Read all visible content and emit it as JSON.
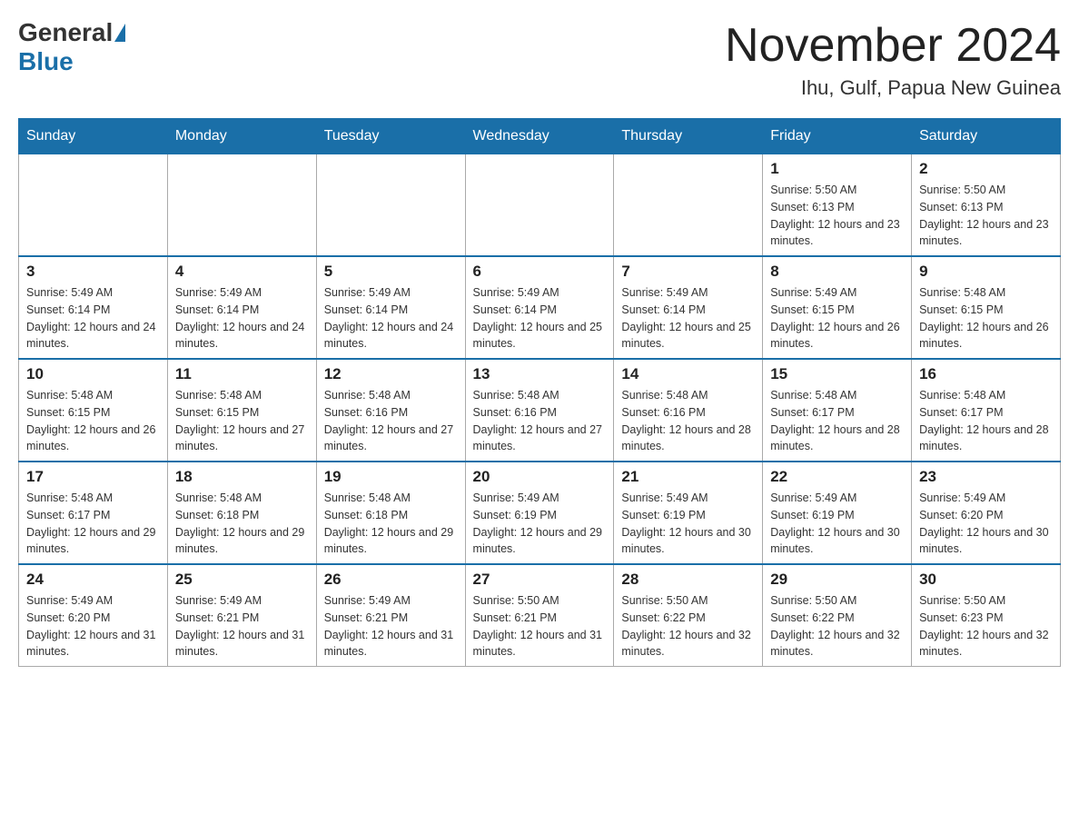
{
  "header": {
    "logo_general": "General",
    "logo_blue": "Blue",
    "month": "November 2024",
    "location": "Ihu, Gulf, Papua New Guinea"
  },
  "days_of_week": [
    "Sunday",
    "Monday",
    "Tuesday",
    "Wednesday",
    "Thursday",
    "Friday",
    "Saturday"
  ],
  "weeks": [
    [
      {
        "day": "",
        "info": ""
      },
      {
        "day": "",
        "info": ""
      },
      {
        "day": "",
        "info": ""
      },
      {
        "day": "",
        "info": ""
      },
      {
        "day": "",
        "info": ""
      },
      {
        "day": "1",
        "info": "Sunrise: 5:50 AM\nSunset: 6:13 PM\nDaylight: 12 hours and 23 minutes."
      },
      {
        "day": "2",
        "info": "Sunrise: 5:50 AM\nSunset: 6:13 PM\nDaylight: 12 hours and 23 minutes."
      }
    ],
    [
      {
        "day": "3",
        "info": "Sunrise: 5:49 AM\nSunset: 6:14 PM\nDaylight: 12 hours and 24 minutes."
      },
      {
        "day": "4",
        "info": "Sunrise: 5:49 AM\nSunset: 6:14 PM\nDaylight: 12 hours and 24 minutes."
      },
      {
        "day": "5",
        "info": "Sunrise: 5:49 AM\nSunset: 6:14 PM\nDaylight: 12 hours and 24 minutes."
      },
      {
        "day": "6",
        "info": "Sunrise: 5:49 AM\nSunset: 6:14 PM\nDaylight: 12 hours and 25 minutes."
      },
      {
        "day": "7",
        "info": "Sunrise: 5:49 AM\nSunset: 6:14 PM\nDaylight: 12 hours and 25 minutes."
      },
      {
        "day": "8",
        "info": "Sunrise: 5:49 AM\nSunset: 6:15 PM\nDaylight: 12 hours and 26 minutes."
      },
      {
        "day": "9",
        "info": "Sunrise: 5:48 AM\nSunset: 6:15 PM\nDaylight: 12 hours and 26 minutes."
      }
    ],
    [
      {
        "day": "10",
        "info": "Sunrise: 5:48 AM\nSunset: 6:15 PM\nDaylight: 12 hours and 26 minutes."
      },
      {
        "day": "11",
        "info": "Sunrise: 5:48 AM\nSunset: 6:15 PM\nDaylight: 12 hours and 27 minutes."
      },
      {
        "day": "12",
        "info": "Sunrise: 5:48 AM\nSunset: 6:16 PM\nDaylight: 12 hours and 27 minutes."
      },
      {
        "day": "13",
        "info": "Sunrise: 5:48 AM\nSunset: 6:16 PM\nDaylight: 12 hours and 27 minutes."
      },
      {
        "day": "14",
        "info": "Sunrise: 5:48 AM\nSunset: 6:16 PM\nDaylight: 12 hours and 28 minutes."
      },
      {
        "day": "15",
        "info": "Sunrise: 5:48 AM\nSunset: 6:17 PM\nDaylight: 12 hours and 28 minutes."
      },
      {
        "day": "16",
        "info": "Sunrise: 5:48 AM\nSunset: 6:17 PM\nDaylight: 12 hours and 28 minutes."
      }
    ],
    [
      {
        "day": "17",
        "info": "Sunrise: 5:48 AM\nSunset: 6:17 PM\nDaylight: 12 hours and 29 minutes."
      },
      {
        "day": "18",
        "info": "Sunrise: 5:48 AM\nSunset: 6:18 PM\nDaylight: 12 hours and 29 minutes."
      },
      {
        "day": "19",
        "info": "Sunrise: 5:48 AM\nSunset: 6:18 PM\nDaylight: 12 hours and 29 minutes."
      },
      {
        "day": "20",
        "info": "Sunrise: 5:49 AM\nSunset: 6:19 PM\nDaylight: 12 hours and 29 minutes."
      },
      {
        "day": "21",
        "info": "Sunrise: 5:49 AM\nSunset: 6:19 PM\nDaylight: 12 hours and 30 minutes."
      },
      {
        "day": "22",
        "info": "Sunrise: 5:49 AM\nSunset: 6:19 PM\nDaylight: 12 hours and 30 minutes."
      },
      {
        "day": "23",
        "info": "Sunrise: 5:49 AM\nSunset: 6:20 PM\nDaylight: 12 hours and 30 minutes."
      }
    ],
    [
      {
        "day": "24",
        "info": "Sunrise: 5:49 AM\nSunset: 6:20 PM\nDaylight: 12 hours and 31 minutes."
      },
      {
        "day": "25",
        "info": "Sunrise: 5:49 AM\nSunset: 6:21 PM\nDaylight: 12 hours and 31 minutes."
      },
      {
        "day": "26",
        "info": "Sunrise: 5:49 AM\nSunset: 6:21 PM\nDaylight: 12 hours and 31 minutes."
      },
      {
        "day": "27",
        "info": "Sunrise: 5:50 AM\nSunset: 6:21 PM\nDaylight: 12 hours and 31 minutes."
      },
      {
        "day": "28",
        "info": "Sunrise: 5:50 AM\nSunset: 6:22 PM\nDaylight: 12 hours and 32 minutes."
      },
      {
        "day": "29",
        "info": "Sunrise: 5:50 AM\nSunset: 6:22 PM\nDaylight: 12 hours and 32 minutes."
      },
      {
        "day": "30",
        "info": "Sunrise: 5:50 AM\nSunset: 6:23 PM\nDaylight: 12 hours and 32 minutes."
      }
    ]
  ]
}
